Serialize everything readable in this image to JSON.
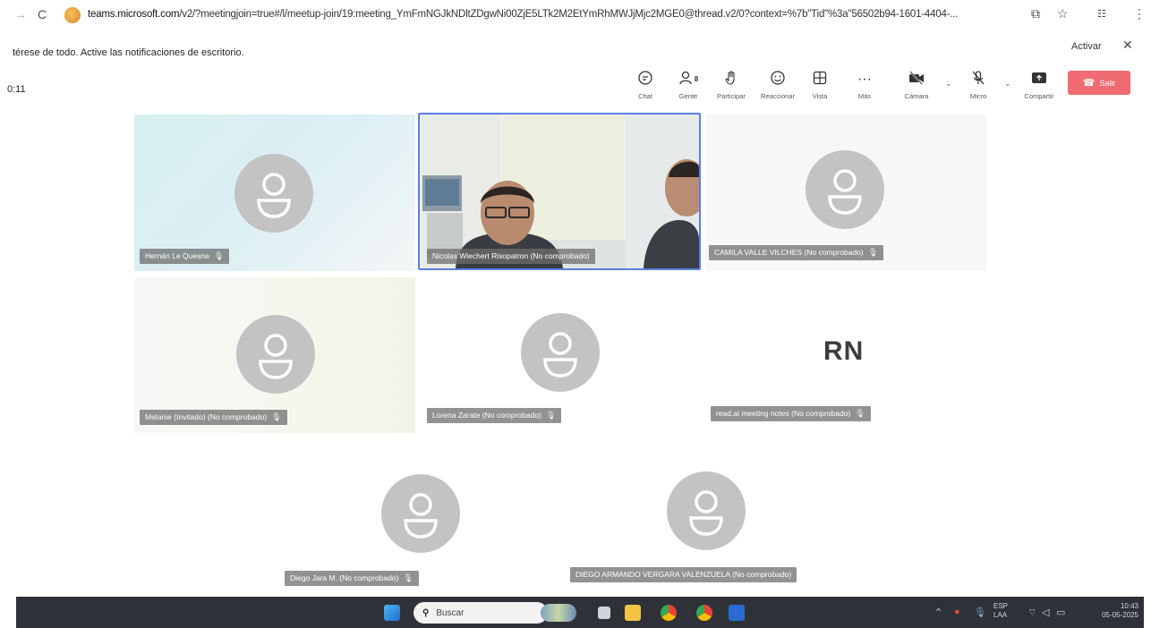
{
  "browser": {
    "back_icon": "arrow-left",
    "reload_icon": "reload",
    "url_host": "teams.microsoft.com",
    "url_rest": "/v2/?meetingjoin=true#/l/meetup-join/19:meeting_YmFmNGJkNDltZDgwNi00ZjE5LTk2M2EtYmRhMWJjMjc2MGE0@thread.v2/0?context=%7b\"Tid\"%3a\"56502b94-1601-4404-...",
    "icons": [
      "install-app-icon",
      "star-icon",
      "extensions-icon",
      "kebab-menu-icon"
    ]
  },
  "notification": {
    "text": "térese de todo. Active las notificaciones de escritorio.",
    "action": "Activar"
  },
  "meeting": {
    "timer": "0:11",
    "toolbar": {
      "chat": "Chat",
      "people": "Gente",
      "people_count": "8",
      "raise": "Participar",
      "react": "Reaccionar",
      "view": "Vista",
      "more": "Más",
      "camera": "Cámara",
      "mic": "Micro",
      "share": "Compartir",
      "leave": "Salir"
    },
    "participants": [
      {
        "name": "Hernán Le Quesne"
      },
      {
        "name": "Nicolas Wiechert Risopatron (No comprobado)"
      },
      {
        "name": "CAMILA VALLE VILCHES (No comprobado)"
      },
      {
        "name": "Melanie (Invitado) (No comprobado)"
      },
      {
        "name": "Lorena Zarate (No comprobado)"
      },
      {
        "name": "read.ai meeting notes (No comprobado)",
        "initials": "RN"
      },
      {
        "name": "Diego Jara M. (No comprobado)"
      },
      {
        "name": "DIEGO ARMANDO VERGARA VALENZUELA (No comprobado)"
      }
    ]
  },
  "taskbar": {
    "search_placeholder": "Buscar",
    "language": "ESP",
    "layout": "LAA",
    "time": "10:43",
    "date": "05-05-2025"
  },
  "colors": {
    "leave_button": "#f06b72",
    "active_speaker_border": "#5b7ee5",
    "taskbar": "#2e3138",
    "avatar": "#c3c3c3"
  }
}
